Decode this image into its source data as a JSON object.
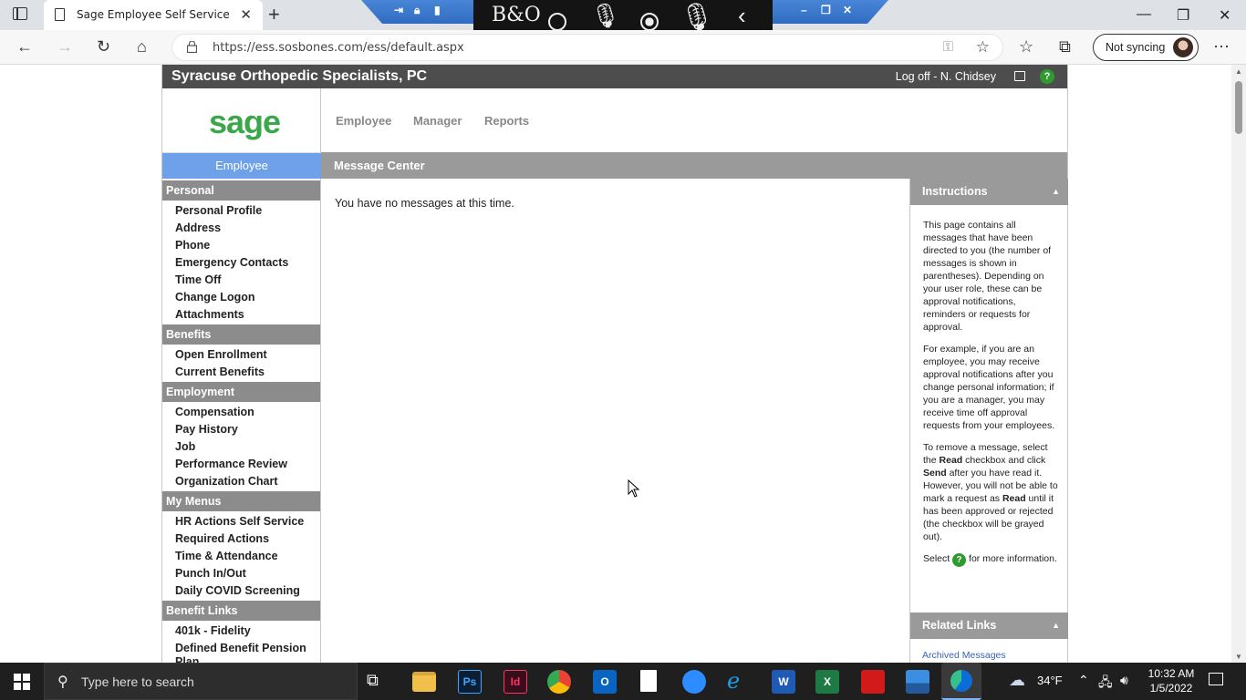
{
  "browser": {
    "tab_title": "Sage Employee Self Service",
    "url": "https://ess.sosbones.com/ess/default.aspx",
    "sync_label": "Not syncing",
    "remote_toolbar": {
      "icons": [
        "pin-icon",
        "lock-icon",
        "signal-icon",
        "minimize-icon",
        "restore-icon",
        "close-icon"
      ]
    },
    "bo_panel": {
      "logo": "B&O",
      "icons": [
        "circle-icon",
        "microphone-icon",
        "record-icon",
        "mic-waves-icon",
        "back-chevron-icon"
      ]
    }
  },
  "app": {
    "company": "Syracuse Orthopedic Specialists, PC",
    "logoff": "Log off - N. Chidsey",
    "logo": "sage",
    "topnav": [
      "Employee",
      "Manager",
      "Reports"
    ],
    "active_section": "Employee",
    "sidebar": {
      "personal": {
        "label": "Personal",
        "items": [
          "Personal Profile",
          "Address",
          "Phone",
          "Emergency Contacts",
          "Time Off",
          "Change Logon",
          "Attachments"
        ]
      },
      "benefits": {
        "label": "Benefits",
        "items": [
          "Open Enrollment",
          "Current Benefits"
        ]
      },
      "employment": {
        "label": "Employment",
        "items": [
          "Compensation",
          "Pay History",
          "Job",
          "Performance Review",
          "Organization Chart"
        ]
      },
      "mymenus": {
        "label": "My Menus",
        "items": [
          "HR Actions Self Service",
          "Required Actions",
          "Time & Attendance",
          "Punch In/Out",
          "Daily COVID Screening"
        ]
      },
      "benefitlinks": {
        "label": "Benefit Links",
        "items": [
          "401k - Fidelity",
          "Defined Benefit Pension Plan"
        ]
      }
    },
    "message_center": {
      "title": "Message Center",
      "empty_text": "You have no messages at this time."
    },
    "instructions": {
      "title": "Instructions",
      "p1": "This page contains all messages that have been directed to you (the number of messages is shown in parentheses). Depending on your user role, these can be approval notifications, reminders or requests for approval.",
      "p2": "For example, if you are an employee, you may receive approval notifications after you change personal information; if you are a manager, you may receive time off approval requests from your employees.",
      "p3_a": "To remove a message, select the ",
      "p3_read": "Read",
      "p3_b": " checkbox and click ",
      "p3_send": "Send",
      "p3_c": " after you have read it. However, you will not be able to mark a request as ",
      "p3_read2": "Read",
      "p3_d": " until it has been approved or rejected (the checkbox will be grayed out).",
      "p4_a": "Select ",
      "p4_b": " for more information."
    },
    "related_links": {
      "title": "Related Links",
      "items": [
        "Archived Messages"
      ]
    }
  },
  "taskbar": {
    "search_placeholder": "Type here to search",
    "temperature": "34°F",
    "time": "10:32 AM",
    "date": "1/5/2022",
    "apps": [
      "task-view",
      "file-explorer",
      "photoshop",
      "indesign",
      "chrome",
      "outlook",
      "notepad",
      "zoom",
      "internet-explorer",
      "word",
      "excel",
      "acrobat",
      "photos",
      "edge"
    ]
  },
  "colors": {
    "header_dark": "#4d4d4d",
    "nav_active": "#6fa0ea",
    "section_gray": "#8c8c8c",
    "sage_green": "#3aa84a",
    "help_green": "#2d9b2d",
    "link_blue": "#3a62b4"
  }
}
